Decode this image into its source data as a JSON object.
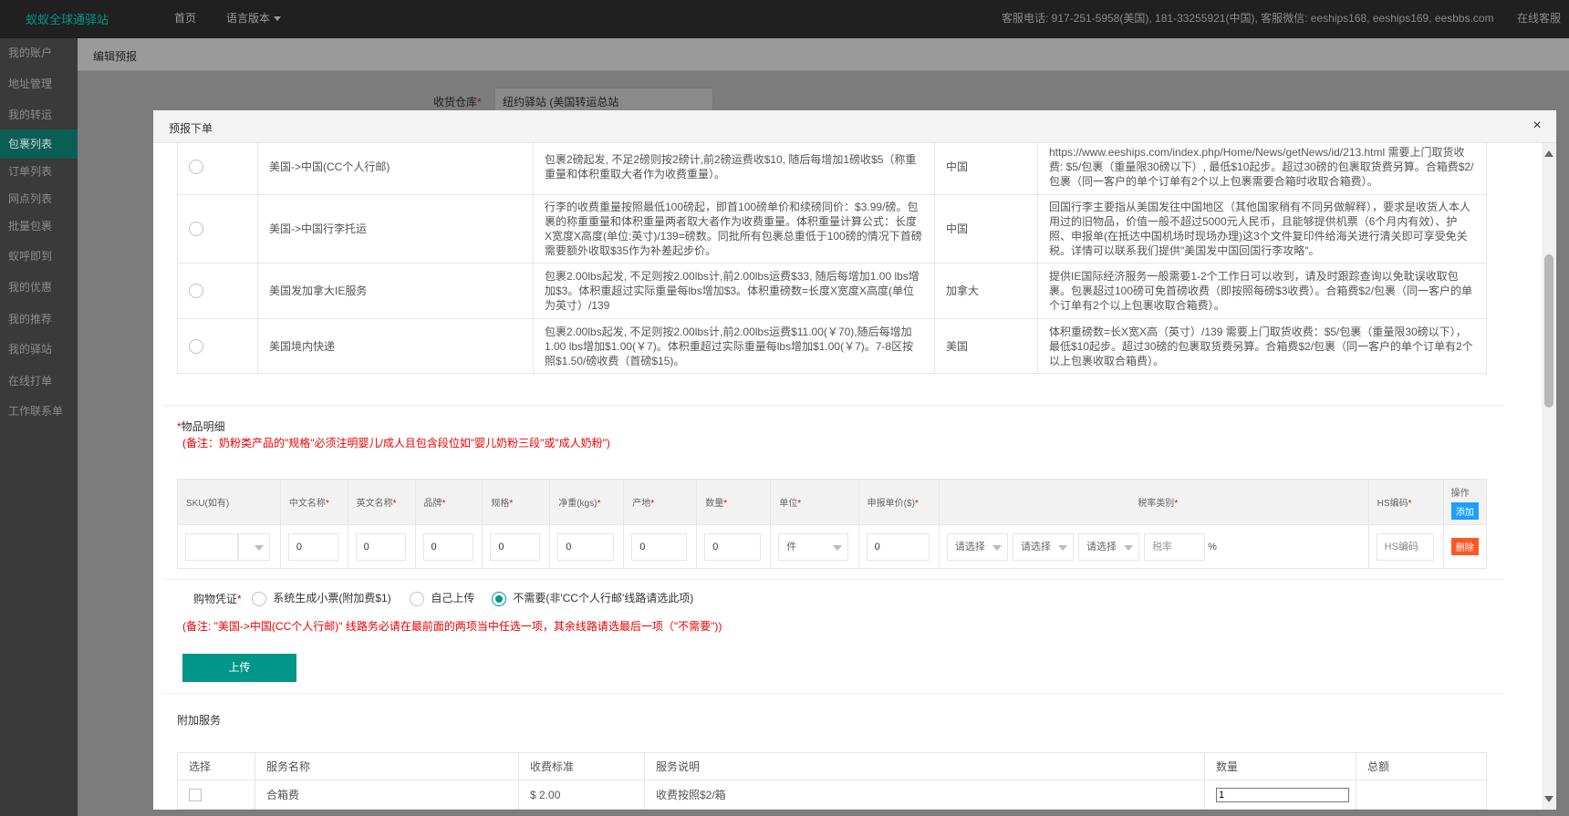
{
  "topbar": {
    "brand": "蚁蚁全球通驿站",
    "nav_home": "首页",
    "nav_language": "语言版本",
    "contact": "客服电话: 917-251-5958(美国), 181-33255921(中国), 客服微信: eeships168, eeships169, eesbbs.com",
    "online_service": "在线客服"
  },
  "sidebar": {
    "items": [
      {
        "label": "我的账户"
      },
      {
        "label": "地址管理"
      },
      {
        "label": "我的转运"
      },
      {
        "label": "包裹列表"
      },
      {
        "label": "订单列表"
      },
      {
        "label": "网点列表"
      },
      {
        "label": "批量包裹"
      },
      {
        "label": "蚁呼即到"
      },
      {
        "label": "我的优惠"
      },
      {
        "label": "我的推荐"
      },
      {
        "label": "我的驿站"
      },
      {
        "label": "在线打单"
      },
      {
        "label": "工作联系单"
      }
    ],
    "active_index": 3
  },
  "page": {
    "breadcrumb": "编辑预报",
    "warehouse_label": "收货仓库",
    "warehouse_value": "纽约驿站 (美国转运总站"
  },
  "modal": {
    "title": "预报下单",
    "close_label": "×"
  },
  "routes": [
    {
      "name": "美国->中国(CC个人行邮)",
      "fee": "包裹2磅起发, 不足2磅则按2磅计,前2磅运费收$10, 随后每增加1磅收$5（称重重量和体积重取大者作为收费重量）。",
      "country": "中国",
      "note": "https://www.eeships.com/index.php/Home/News/getNews/id/213.html 需要上门取货收费: $5/包裹（重量限30磅以下）, 最低$10起步。超过30磅的包裹取货费另算。合箱费$2/包裹（同一客户的单个订单有2个以上包裹需要合箱时收取合箱费）。"
    },
    {
      "name": "美国->中国行李托运",
      "fee": "行李的收费重量按照最低100磅起，即首100磅单价和续磅同价：$3.99/磅。包裹的称重重量和体积重量两者取大者作为收费重量。体积重量计算公式：长度X宽度X高度(单位:英寸)/139=磅数。同批所有包裹总重低于100磅的情况下首磅需要额外收取$35作为补差起步价。",
      "country": "中国",
      "note": "回国行李主要指从美国发往中国地区（其他国家稍有不同另做解释），要求是收货人本人用过的旧物品，价值一般不超过5000元人民币，且能够提供机票（6个月内有效）、护照、申报单(在抵达中国机场时现场办理)这3个文件复印件给海关进行清关即可享受免关税。详情可以联系我们提供\"美国发中国回国行李攻略\"。"
    },
    {
      "name": "美国发加拿大IE服务",
      "fee": "包裹2.00lbs起发, 不足则按2.00lbs计,前2.00lbs运费$33, 随后每增加1.00 lbs增加$3。体积重超过实际重量每lbs增加$3。体积重磅数=长度X宽度X高度(单位为英寸）/139",
      "country": "加拿大",
      "note": "提供IE国际经济服务一般需要1-2个工作日可以收到，请及时跟踪查询以免耽误收取包裹。包裹超过100磅可免首磅收费（即按照每磅$3收费）。合箱费$2/包裹（同一客户的单个订单有2个以上包裹收取合箱费）。"
    },
    {
      "name": "美国境内快递",
      "fee": "包裹2.00lbs起发, 不足则按2.00lbs计,前2.00lbs运费$11.00(￥70),随后每增加1.00 lbs增加$1.00(￥7)。体积重超过实际重量每lbs增加$1.00(￥7)。7-8区按照$1.50/磅收费（首磅$15)。",
      "country": "美国",
      "note": "体积重磅数=长X宽X高（英寸）/139 需要上门取货收费：$5/包裹（重量限30磅以下），最低$10起步。超过30磅的包裹取货费另算。合箱费$2/包裹（同一客户的单个订单有2个以上包裹收取合箱费）。"
    }
  ],
  "items_section": {
    "title": "物品明细",
    "note": "(备注：奶粉类产品的\"规格\"必须注明婴儿/成人且包含段位如\"婴儿奶粉三段\"或\"成人奶粉\")",
    "headers": {
      "sku": "SKU(如有)",
      "cn_name": "中文名称",
      "en_name": "英文名称",
      "brand": "品牌",
      "spec": "规格",
      "net_weight": "净重(kgs)",
      "origin": "产地",
      "quantity": "数量",
      "unit": "单位",
      "price": "申报单价($)",
      "tax_category": "税率类别",
      "hs_code": "HS编码",
      "action": "操作"
    },
    "add_label": "添加",
    "row": {
      "cn_name": "0",
      "en_name": "0",
      "brand": "0",
      "spec": "0",
      "net_weight": "0",
      "origin": "0",
      "quantity": "0",
      "unit": "件",
      "price": "0",
      "tax_select_1": "请选择",
      "tax_select_2": "请选择",
      "tax_select_3": "请选择",
      "tax_rate_placeholder": "税率",
      "percent": "%",
      "hs_placeholder": "HS编码",
      "delete_label": "删除"
    }
  },
  "receipt": {
    "label": "购物凭证",
    "options": [
      {
        "label": "系统生成小票(附加费$1)",
        "checked": false
      },
      {
        "label": "自己上传",
        "checked": false
      },
      {
        "label": "不需要(非'CC个人行邮'线路请选此项)",
        "checked": true
      }
    ],
    "note": "(备注: \"美国->中国(CC个人行邮)\" 线路务必请在最前面的两项当中任选一项，其余线路请选最后一项（\"不需要\"))",
    "upload_label": "上传"
  },
  "services": {
    "title": "附加服务",
    "headers": [
      "选择",
      "服务名称",
      "收费标准",
      "服务说明",
      "数量",
      "总额"
    ],
    "rows": [
      {
        "name": "合箱费",
        "fee": "$ 2.00",
        "desc": "收费按照$2/箱",
        "qty": "1",
        "total": ""
      }
    ]
  },
  "colors": {
    "accent": "#009688",
    "danger": "#ff5722",
    "info": "#1e9fff",
    "note_red": "#e00000"
  }
}
